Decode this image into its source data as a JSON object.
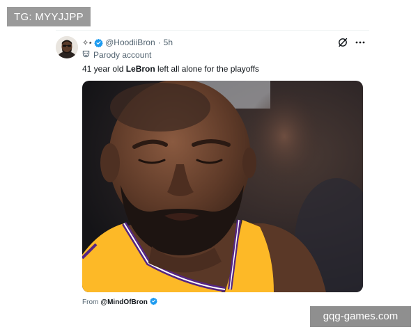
{
  "watermarks": {
    "top": "TG: MYYJJPP",
    "bottom": "gqg-games.com"
  },
  "tweet": {
    "display_name_icon": "sparkles-icon",
    "handle": "@HoodiiBron",
    "separator": "·",
    "time": "5h",
    "parody_label": "Parody account",
    "text_before": "41 year old ",
    "text_bold": "LeBron",
    "text_after": " left all alone for the playoffs",
    "from_label": "From",
    "from_handle": "@MindOfBron",
    "colors": {
      "verified": "#1d9bf0",
      "secondary_text": "#536471",
      "jersey_gold": "#fdb927",
      "jersey_purple": "#552583"
    },
    "icons": [
      "grok-icon",
      "more-icon",
      "verified-badge-icon",
      "parody-mask-icon"
    ]
  }
}
